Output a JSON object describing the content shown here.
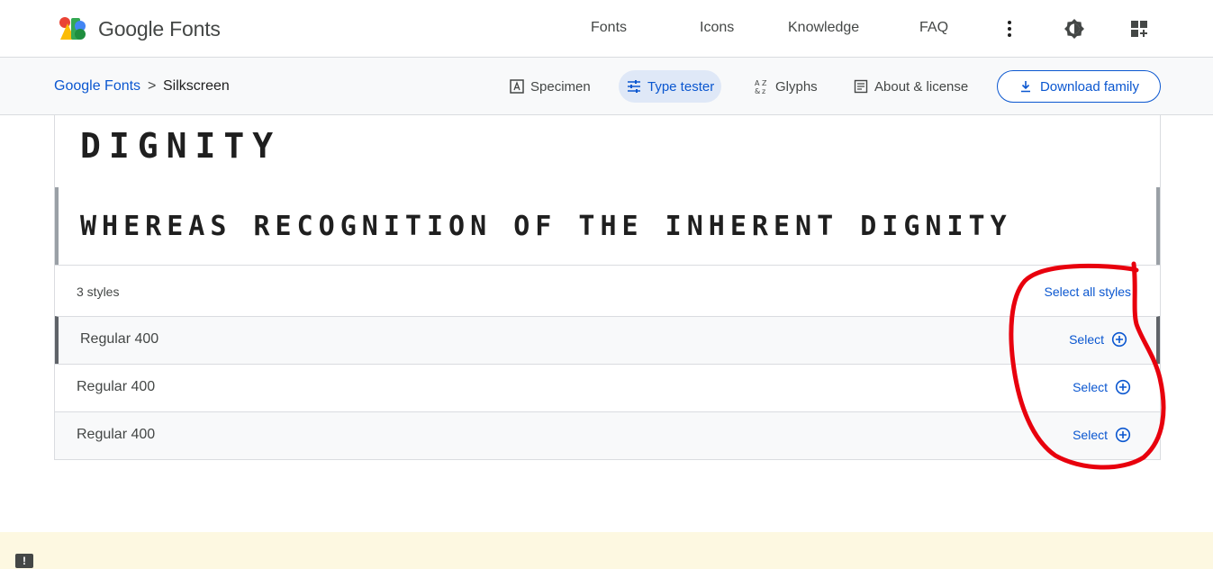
{
  "header": {
    "brand": "Google Fonts",
    "nav": [
      "Fonts",
      "Icons",
      "Knowledge",
      "FAQ"
    ]
  },
  "subbar": {
    "breadcrumb_root": "Google Fonts",
    "breadcrumb_sep": ">",
    "breadcrumb_current": "Silkscreen",
    "tabs": [
      "Specimen",
      "Type tester",
      "Glyphs",
      "About & license"
    ],
    "active_tab": "Type tester",
    "download_label": "Download family"
  },
  "preview": {
    "line1": "DIGNITY",
    "line2": "WHEREAS RECOGNITION OF THE INHERENT DIGNITY"
  },
  "styles": {
    "count_label": "3 styles",
    "select_all": "Select all styles",
    "items": [
      {
        "name": "Regular 400",
        "action": "Select"
      },
      {
        "name": "Regular 400",
        "action": "Select"
      },
      {
        "name": "Regular 400",
        "action": "Select"
      }
    ]
  },
  "feedback_icon": "!",
  "colors": {
    "accent": "#0b57d0",
    "annotation": "#e8000d",
    "footer_bg": "#fdf8e1"
  }
}
